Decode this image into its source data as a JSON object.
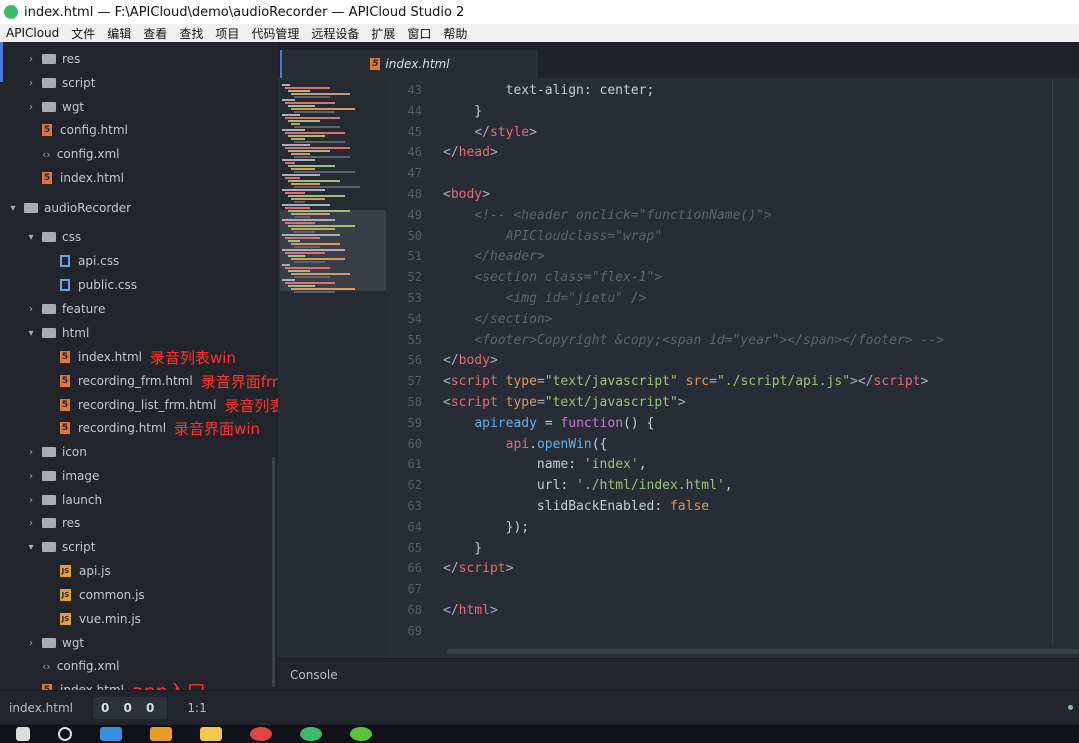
{
  "window": {
    "title": "index.html — F:\\APICloud\\demo\\audioRecorder — APICloud Studio 2"
  },
  "menu": [
    "APICloud",
    "文件",
    "编辑",
    "查看",
    "查找",
    "项目",
    "代码管理",
    "远程设备",
    "扩展",
    "窗口",
    "帮助"
  ],
  "tree": [
    {
      "label": "res",
      "type": "folder",
      "depth": 1,
      "open": false
    },
    {
      "label": "script",
      "type": "folder",
      "depth": 1,
      "open": false
    },
    {
      "label": "wgt",
      "type": "folder",
      "depth": 1,
      "open": false
    },
    {
      "label": "config.html",
      "type": "html",
      "depth": 1
    },
    {
      "label": "config.xml",
      "type": "xml",
      "depth": 1
    },
    {
      "label": "index.html",
      "type": "html",
      "depth": 1
    },
    {
      "label": "audioRecorder",
      "type": "folder",
      "depth": 0,
      "open": true
    },
    {
      "label": "css",
      "type": "folder",
      "depth": 1,
      "open": true
    },
    {
      "label": "api.css",
      "type": "css",
      "depth": 2
    },
    {
      "label": "public.css",
      "type": "css",
      "depth": 2
    },
    {
      "label": "feature",
      "type": "folder",
      "depth": 1,
      "open": false
    },
    {
      "label": "html",
      "type": "folder",
      "depth": 1,
      "open": true
    },
    {
      "label": "index.html",
      "type": "html",
      "depth": 2,
      "note": "录音列表win"
    },
    {
      "label": "recording_frm.html",
      "type": "html",
      "depth": 2,
      "note": "录音界面frm"
    },
    {
      "label": "recording_list_frm.html",
      "type": "html",
      "depth": 2,
      "note": "录音列表frm"
    },
    {
      "label": "recording.html",
      "type": "html",
      "depth": 2,
      "note": "录音界面win"
    },
    {
      "label": "icon",
      "type": "folder",
      "depth": 1,
      "open": false
    },
    {
      "label": "image",
      "type": "folder",
      "depth": 1,
      "open": false
    },
    {
      "label": "launch",
      "type": "folder",
      "depth": 1,
      "open": false
    },
    {
      "label": "res",
      "type": "folder",
      "depth": 1,
      "open": false
    },
    {
      "label": "script",
      "type": "folder",
      "depth": 1,
      "open": true
    },
    {
      "label": "api.js",
      "type": "js",
      "depth": 2
    },
    {
      "label": "common.js",
      "type": "js",
      "depth": 2
    },
    {
      "label": "vue.min.js",
      "type": "js",
      "depth": 2
    },
    {
      "label": "wgt",
      "type": "folder",
      "depth": 1,
      "open": false
    },
    {
      "label": "config.xml",
      "type": "xml",
      "depth": 1
    },
    {
      "label": "index.html",
      "type": "html",
      "depth": 1,
      "note": "app入口"
    }
  ],
  "editor": {
    "tab_label": "index.html",
    "first_line": 43,
    "lines": [
      [
        [
          "plain",
          "        text-align: center;"
        ]
      ],
      [
        [
          "plain",
          "    }"
        ]
      ],
      [
        [
          "plain",
          "    "
        ],
        [
          "br",
          "</"
        ],
        [
          "tag",
          "style"
        ],
        [
          "br",
          ">"
        ]
      ],
      [
        [
          "br",
          "</"
        ],
        [
          "tag",
          "head"
        ],
        [
          "br",
          ">"
        ]
      ],
      [],
      [
        [
          "br",
          "<"
        ],
        [
          "tag",
          "body"
        ],
        [
          "br",
          ">"
        ]
      ],
      [
        [
          "com",
          "    <!-- <header onclick=\"functionName()\">"
        ]
      ],
      [
        [
          "com",
          "        APICloudclass=\"wrap\""
        ]
      ],
      [
        [
          "com",
          "    </header>"
        ]
      ],
      [
        [
          "com",
          "    <section class=\"flex-1\">"
        ]
      ],
      [
        [
          "com",
          "        <img id=\"jietu\" />"
        ]
      ],
      [
        [
          "com",
          "    </section>"
        ]
      ],
      [
        [
          "com",
          "    <footer>Copyright &copy;<span id=\"year\"></span></footer> -->"
        ]
      ],
      [
        [
          "br",
          "</"
        ],
        [
          "tag",
          "body"
        ],
        [
          "br",
          ">"
        ]
      ],
      [
        [
          "br",
          "<"
        ],
        [
          "tag",
          "script"
        ],
        [
          "plain",
          " "
        ],
        [
          "attr",
          "type"
        ],
        [
          "br",
          "="
        ],
        [
          "str",
          "\"text/javascript\""
        ],
        [
          "plain",
          " "
        ],
        [
          "attr",
          "src"
        ],
        [
          "br",
          "="
        ],
        [
          "str",
          "\"./script/api.js\""
        ],
        [
          "br",
          "></"
        ],
        [
          "tag",
          "script"
        ],
        [
          "br",
          ">"
        ]
      ],
      [
        [
          "br",
          "<"
        ],
        [
          "tag",
          "script"
        ],
        [
          "plain",
          " "
        ],
        [
          "attr",
          "type"
        ],
        [
          "br",
          "="
        ],
        [
          "str",
          "\"text/javascript\""
        ],
        [
          "br",
          ">"
        ]
      ],
      [
        [
          "plain",
          "    "
        ],
        [
          "var",
          "apiready"
        ],
        [
          "plain",
          " = "
        ],
        [
          "kw",
          "function"
        ],
        [
          "plain",
          "() {"
        ]
      ],
      [
        [
          "plain",
          "        "
        ],
        [
          "tag",
          "api"
        ],
        [
          "plain",
          "."
        ],
        [
          "fn",
          "openWin"
        ],
        [
          "plain",
          "({"
        ]
      ],
      [
        [
          "plain",
          "            name: "
        ],
        [
          "str",
          "'index'"
        ],
        [
          "plain",
          ","
        ]
      ],
      [
        [
          "plain",
          "            url: "
        ],
        [
          "str",
          "'./html/index.html'"
        ],
        [
          "plain",
          ","
        ]
      ],
      [
        [
          "plain",
          "            slidBackEnabled: "
        ],
        [
          "bool",
          "false"
        ]
      ],
      [
        [
          "plain",
          "        });"
        ]
      ],
      [
        [
          "plain",
          "    }"
        ]
      ],
      [
        [
          "br",
          "</"
        ],
        [
          "tag",
          "script"
        ],
        [
          "br",
          ">"
        ]
      ],
      [],
      [
        [
          "br",
          "</"
        ],
        [
          "tag",
          "html"
        ],
        [
          "br",
          ">"
        ]
      ],
      []
    ]
  },
  "console": {
    "label": "Console"
  },
  "status": {
    "file": "index.html",
    "counts": "0 0 0",
    "position": "1:1"
  },
  "colors": {
    "accent": "#4a7bd0",
    "annotation": "#ff3030",
    "background": "#282c34",
    "sidebar": "#21252b"
  }
}
